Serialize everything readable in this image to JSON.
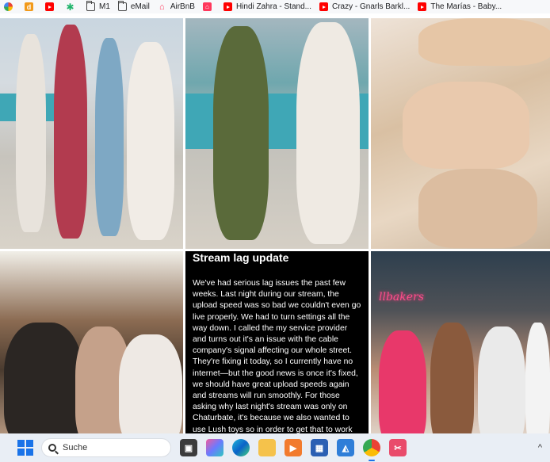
{
  "bookmarks": [
    {
      "icon": "google-icon",
      "label": ""
    },
    {
      "icon": "d-icon",
      "label": ""
    },
    {
      "icon": "youtube-icon",
      "label": ""
    },
    {
      "icon": "star-icon",
      "label": ""
    },
    {
      "icon": "folder-icon",
      "label": "M1"
    },
    {
      "icon": "folder-icon",
      "label": "eMail"
    },
    {
      "icon": "airbnb-icon",
      "label": "AirBnB"
    },
    {
      "icon": "airbnb-red-icon",
      "label": ""
    },
    {
      "icon": "youtube-icon",
      "label": "Hindi Zahra - Stand..."
    },
    {
      "icon": "youtube-icon",
      "label": "Crazy - Gnarls Barkl..."
    },
    {
      "icon": "youtube-icon",
      "label": "The Marías - Baby..."
    }
  ],
  "post": {
    "title": "Stream lag update",
    "body": "We've had serious lag issues the past few weeks. Last night during our stream, the upload speed was so bad we couldn't even go live properly. We had to turn settings all the way down. I called the my service provider and turns out it's an issue with the cable company's signal affecting our whole street. They're fixing it today, so I currently have no internet—but the good news is once it's fixed, we should have great upload speeds again and streams will run smoothly. For those asking why last night's stream was only on Chaturbate, it's because we also wanted to use Lush toys so in order to get that to work we needed to have two streams, one for Chaturbate and one for everywhere else"
  },
  "photos": {
    "t6_sign": "llbakers"
  },
  "taskbar": {
    "search_placeholder": "Suche",
    "apps": [
      "task-view-icon",
      "copilot-icon",
      "edge-icon",
      "file-explorer-icon",
      "media-player-icon",
      "store-icon",
      "photos-icon",
      "chrome-icon",
      "snipping-tool-icon"
    ],
    "tray_chevron": "^"
  },
  "colors": {
    "taskbar_bg": "#e9eef5",
    "accent": "#1a73e8",
    "post_bg": "#000000"
  }
}
